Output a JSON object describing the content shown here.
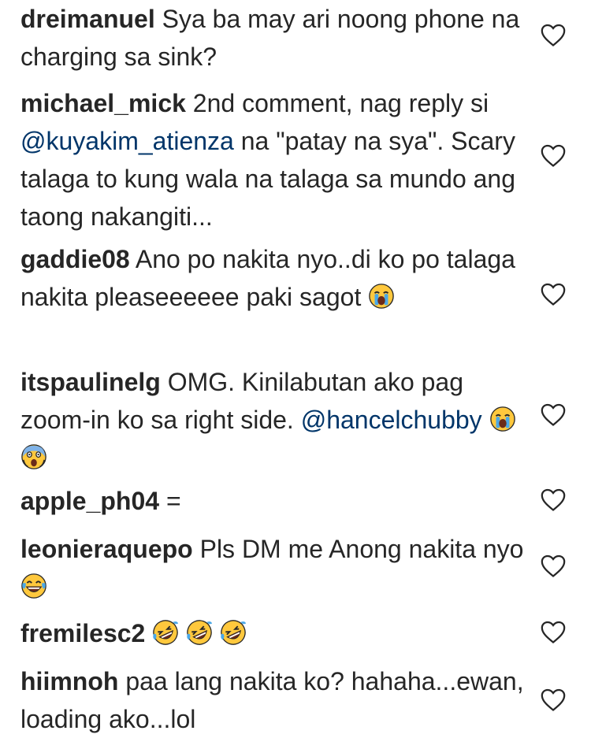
{
  "comments": [
    {
      "username": "dreimanuel",
      "text": "Sya ba may ari noong phone na charging sa sink?"
    },
    {
      "username": "michael_mick",
      "text_before": "2nd comment, nag reply si",
      "mention": "@kuyakim_atienza",
      "text_after": "na \"patay na sya\". Scary talaga to kung wala na talaga sa mundo ang taong nakangiti..."
    },
    {
      "username": "gaddie08",
      "text": "Ano po nakita nyo..di ko po talaga nakita pleaseeeeee paki sagot",
      "emojis": [
        "loudly-crying-face-emoji"
      ]
    },
    {
      "username": "itspaulinelg",
      "text": "OMG. Kinilabutan ako pag zoom-in ko sa right side.",
      "mention": "@hancelchubby",
      "emojis": [
        "loudly-crying-face-emoji",
        "face-screaming-in-fear-emoji"
      ]
    },
    {
      "username": "apple_ph04",
      "text": "="
    },
    {
      "username": "leonieraquepo",
      "text": "Pls DM me Anong nakita nyo",
      "emojis": [
        "face-with-tears-of-joy-emoji"
      ]
    },
    {
      "username": "fremilesc2",
      "emojis": [
        "rolling-on-the-floor-laughing-emoji",
        "rolling-on-the-floor-laughing-emoji",
        "rolling-on-the-floor-laughing-emoji"
      ]
    },
    {
      "username": "hiimnoh",
      "text": "paa lang nakita ko? hahaha...ewan, loading ako...lol"
    }
  ],
  "icons": {
    "like": "heart-outline-icon"
  },
  "colors": {
    "text": "#262626",
    "mention": "#003569",
    "heart_stroke": "#262626",
    "emoji_yellow": "#FFC83D",
    "emoji_tear_blue": "#4AA8E8"
  }
}
